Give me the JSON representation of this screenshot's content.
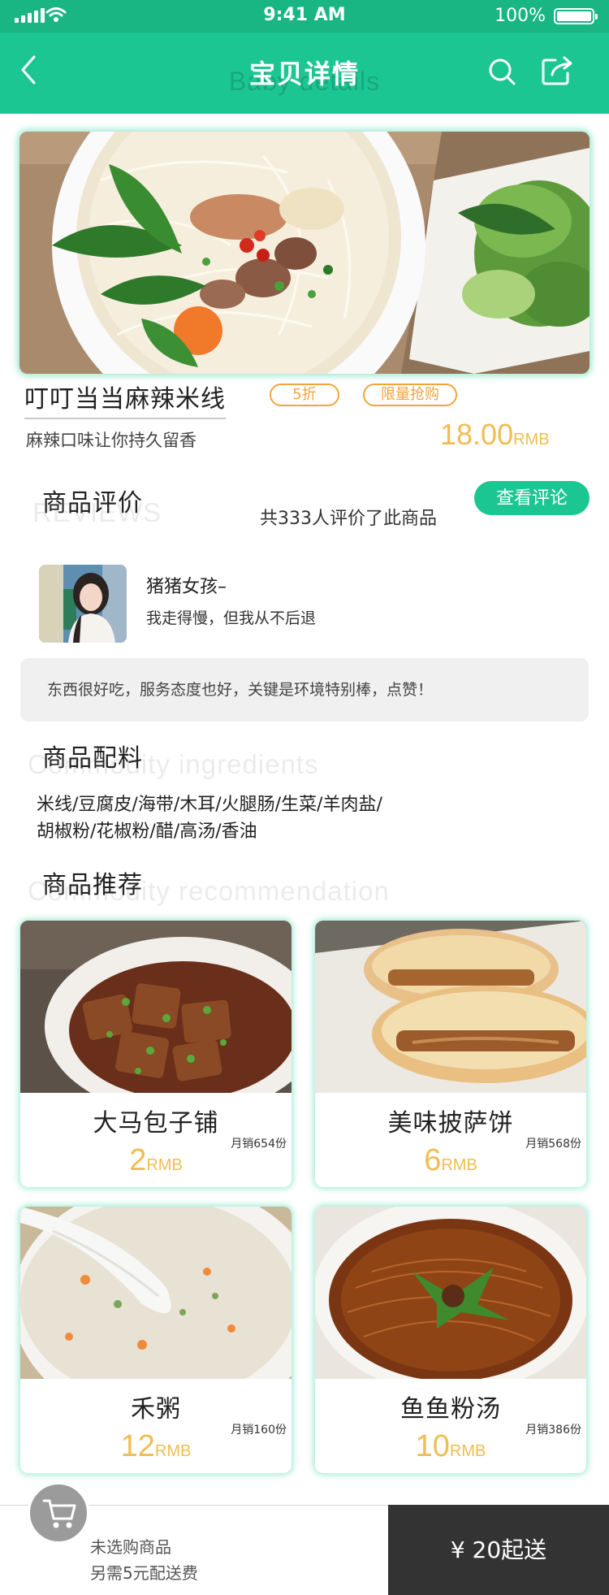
{
  "status_bar": {
    "time": "9:41 AM",
    "battery": "100%"
  },
  "header": {
    "title": "宝贝详情",
    "subtitle": "Baby details"
  },
  "product": {
    "name": "叮叮当当麻辣米线",
    "discount_badge": "5折",
    "limited_badge": "限量抢购",
    "slogan": "麻辣口味让你持久留香",
    "price": "18.00",
    "price_unit": "RMB"
  },
  "reviews": {
    "title": "商品评价",
    "subtitle": "REVIEWS",
    "count_text": "共333人评价了此商品",
    "view_button": "查看评论",
    "reviewer_name": "猪猪女孩–",
    "reviewer_motto": "我走得慢，但我从不后退",
    "comment": "东西很好吃，服务态度也好，关键是环境特别棒，点赞！"
  },
  "ingredients": {
    "title": "商品配料",
    "subtitle": "Commodity ingredients",
    "line1": "米线/豆腐皮/海带/木耳/火腿肠/生菜/羊肉盐/",
    "line2": "胡椒粉/花椒粉/醋/高汤/香油"
  },
  "recommend": {
    "title": "商品推荐",
    "subtitle": "Commodity recommendation",
    "items": [
      {
        "name": "大马包子铺",
        "sales": "月销654份",
        "price": "2",
        "unit": "RMB"
      },
      {
        "name": "美味披萨饼",
        "sales": "月销568份",
        "price": "6",
        "unit": "RMB"
      },
      {
        "name": "禾粥",
        "sales": "月销160份",
        "price": "12",
        "unit": "RMB"
      },
      {
        "name": "鱼鱼粉汤",
        "sales": "月销386份",
        "price": "10",
        "unit": "RMB"
      }
    ]
  },
  "bottom_bar": {
    "line1": "未选购商品",
    "line2": "另需5元配送费",
    "min_order": "¥ 20起送"
  },
  "colors": {
    "brand": "#1cc692",
    "price": "#f0bd52",
    "badge": "#f2a43c",
    "bar_dark": "#333333"
  }
}
